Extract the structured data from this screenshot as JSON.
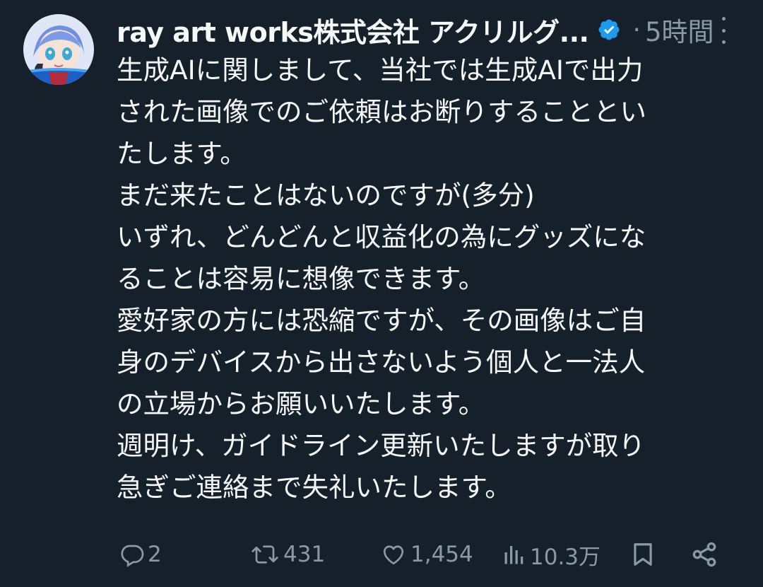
{
  "tweet": {
    "display_name": "ray art works株式会社 アクリルグ...",
    "verified": true,
    "time": "5時間",
    "body_lines": [
      "生成AIに関しまして、当社では生成AIで出力",
      "された画像でのご依頼はお断りすることとい",
      "たします。",
      "まだ来たことはないのですが(多分)",
      "いずれ、どんどんと収益化の為にグッズにな",
      "ることは容易に想像できます。",
      "愛好家の方には恐縮ですが、その画像はご自",
      "身のデバイスから出さないよう個人と一法人",
      "の立場からお願いいたします。",
      "週明け、ガイドライン更新いたしますが取り",
      "急ぎご連絡まで失礼いたします。"
    ]
  },
  "actions": {
    "reply_count": "2",
    "retweet_count": "431",
    "like_count": "1,454",
    "views_count": "10.3万"
  },
  "colors": {
    "background": "#15202b",
    "text": "#f7f9f9",
    "muted": "#8b98a5",
    "verified": "#1d9bf0"
  },
  "icons": [
    "avatar",
    "verified-badge-icon",
    "more-icon",
    "reply-icon",
    "retweet-icon",
    "like-icon",
    "views-icon",
    "bookmark-icon",
    "share-icon"
  ]
}
